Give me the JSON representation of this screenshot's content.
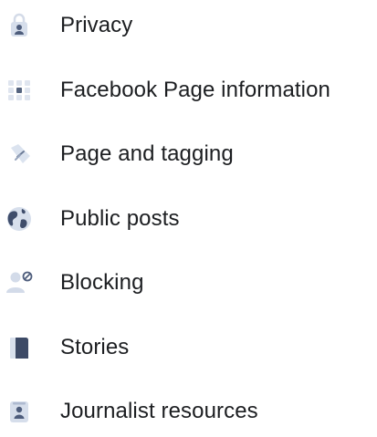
{
  "menu": {
    "items": [
      {
        "label": "Privacy",
        "icon": "privacy-lock-person-icon"
      },
      {
        "label": "Facebook Page information",
        "icon": "page-info-grid-icon"
      },
      {
        "label": "Page and tagging",
        "icon": "tag-icon"
      },
      {
        "label": "Public posts",
        "icon": "globe-icon"
      },
      {
        "label": "Blocking",
        "icon": "blocked-user-icon"
      },
      {
        "label": "Stories",
        "icon": "stories-book-icon"
      },
      {
        "label": "Journalist resources",
        "icon": "journalist-badge-icon"
      }
    ]
  },
  "colors": {
    "text": "#1c1e21",
    "icon_light": "#c8d2e4",
    "icon_dark": "#4a5a7a"
  }
}
